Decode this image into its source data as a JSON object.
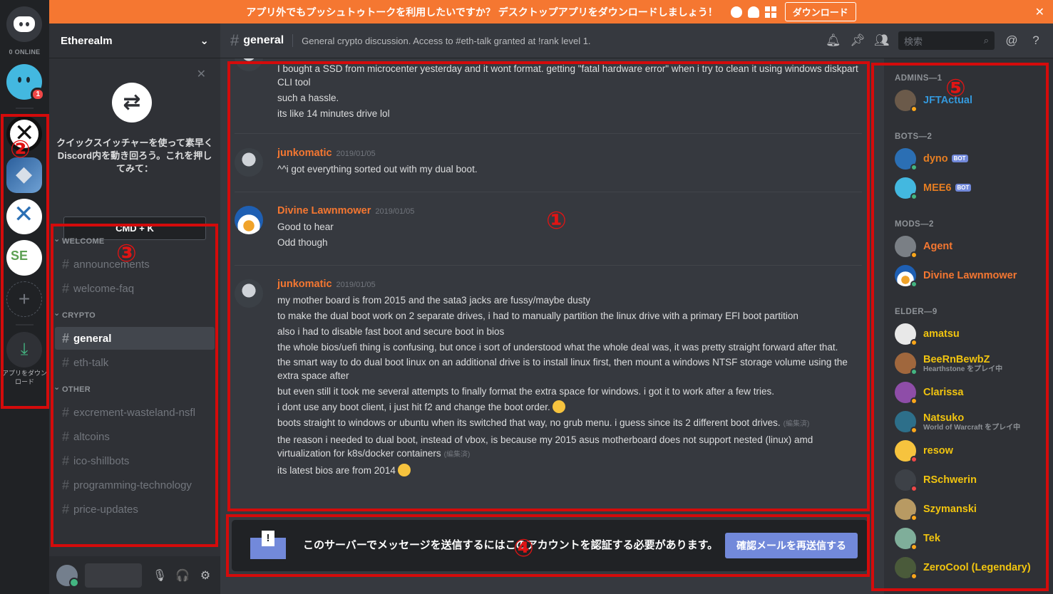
{
  "banner": {
    "text": "アプリ外でもプッシュトゥトークを利用したいですか？ デスクトップアプリをダウンロードしましょう！",
    "button": "ダウンロード",
    "close": "✕"
  },
  "rail": {
    "online": "0 ONLINE",
    "dm_badge": "1",
    "download_label": "アプリをダウンロード"
  },
  "guild": {
    "name": "Etherealm",
    "quick_switcher_text": "クイックスイッチャーを使って素早くDiscord内を動き回ろう。これを押してみて：",
    "shortcut": "CMD + K"
  },
  "categories": [
    {
      "name": "WELCOME",
      "channels": [
        "announcements",
        "welcome-faq"
      ]
    },
    {
      "name": "CRYPTO",
      "channels": [
        "general",
        "eth-talk"
      ]
    },
    {
      "name": "OTHER",
      "channels": [
        "excrement-wasteland-nsfl",
        "altcoins",
        "ico-shillbots",
        "programming-technology",
        "price-updates"
      ]
    }
  ],
  "header": {
    "channel": "general",
    "topic": "General crypto discussion. Access to #eth-talk granted at !rank level 1.",
    "search_placeholder": "検索"
  },
  "messages": [
    {
      "lines": [
        "I bought a SSD from microcenter yesterday and it wont format. getting \"fatal hardware error\" when i try to clean it using windows diskpart CLI tool",
        "such a hassle.",
        "its like 14 minutes drive lol"
      ]
    },
    {
      "author": "junkomatic",
      "time": "2019/01/05",
      "lines": [
        "^^i got everything sorted out with my dual boot."
      ]
    },
    {
      "author": "Divine Lawnmower",
      "time": "2019/01/05",
      "lines": [
        "Good to hear",
        "Odd though"
      ]
    },
    {
      "author": "junkomatic",
      "time": "2019/01/05",
      "lines": [
        "my mother board is from 2015 and the sata3 jacks are fussy/maybe dusty",
        "to make the dual boot work on 2 separate drives, i had to manually partition the linux drive with a primary EFI boot partition",
        "also i had to disable fast boot and secure boot in bios",
        "the whole bios/uefi thing is confusing, but once i sort of understood what the whole deal was, it was pretty straight forward after that.",
        "the smart way to do dual boot linux on an additional drive is to install linux first, then mount a windows NTSF storage volume using the extra space after",
        "but even still it took me several attempts to finally format the extra space for windows. i got it to work after a few tries.",
        "i dont use any boot client, i just hit f2 and change the boot order.",
        "boots straight to windows or ubuntu when its switched that way, no grub menu. i guess since its 2 different boot drives.",
        "the reason i needed to dual boot, instead of vbox, is because my 2015 asus motherboard does not support nested (linux) amd virtualization for k8s/docker containers",
        "its latest bios are from 2014"
      ]
    }
  ],
  "edited_label": "(編集済)",
  "verify": {
    "text": "このサーバーでメッセージを送信するにはこのアカウントを認証する必要があります。",
    "button": "確認メールを再送信する"
  },
  "members": {
    "groups": [
      {
        "title": "ADMINS—1",
        "members": [
          {
            "name": "JFTActual",
            "color": "#3498db",
            "status": "#faa61a"
          }
        ]
      },
      {
        "title": "BOTS—2",
        "members": [
          {
            "name": "dyno",
            "color": "#e67e22",
            "status": "#43b581",
            "bot": "BOT"
          },
          {
            "name": "MEE6",
            "color": "#e67e22",
            "status": "#43b581",
            "bot": "BOT"
          }
        ]
      },
      {
        "title": "MODS—2",
        "members": [
          {
            "name": "Agent",
            "color": "#f57731",
            "status": "#faa61a"
          },
          {
            "name": "Divine Lawnmower",
            "color": "#f57731",
            "status": "#43b581"
          }
        ]
      },
      {
        "title": "ELDER—9",
        "members": [
          {
            "name": "amatsu",
            "color": "#f1c40f",
            "status": "#faa61a"
          },
          {
            "name": "BeeRnBewbZ",
            "color": "#f1c40f",
            "status": "#43b581",
            "activity": "Hearthstone をプレイ中"
          },
          {
            "name": "Clarissa",
            "color": "#f1c40f",
            "status": "#faa61a"
          },
          {
            "name": "Natsuko",
            "color": "#f1c40f",
            "status": "#faa61a",
            "activity": "World of Warcraft をプレイ中"
          },
          {
            "name": "resow",
            "color": "#f1c40f",
            "status": "#f04747"
          },
          {
            "name": "RSchwerin",
            "color": "#f1c40f",
            "status": "#f04747"
          },
          {
            "name": "Szymanski",
            "color": "#f1c40f",
            "status": "#faa61a"
          },
          {
            "name": "Tek",
            "color": "#f1c40f",
            "status": "#faa61a"
          },
          {
            "name": "ZeroCool (Legendary)",
            "color": "#f1c40f",
            "status": "#faa61a"
          }
        ]
      }
    ]
  },
  "annotations": [
    "①",
    "②",
    "③",
    "④",
    "⑤"
  ]
}
